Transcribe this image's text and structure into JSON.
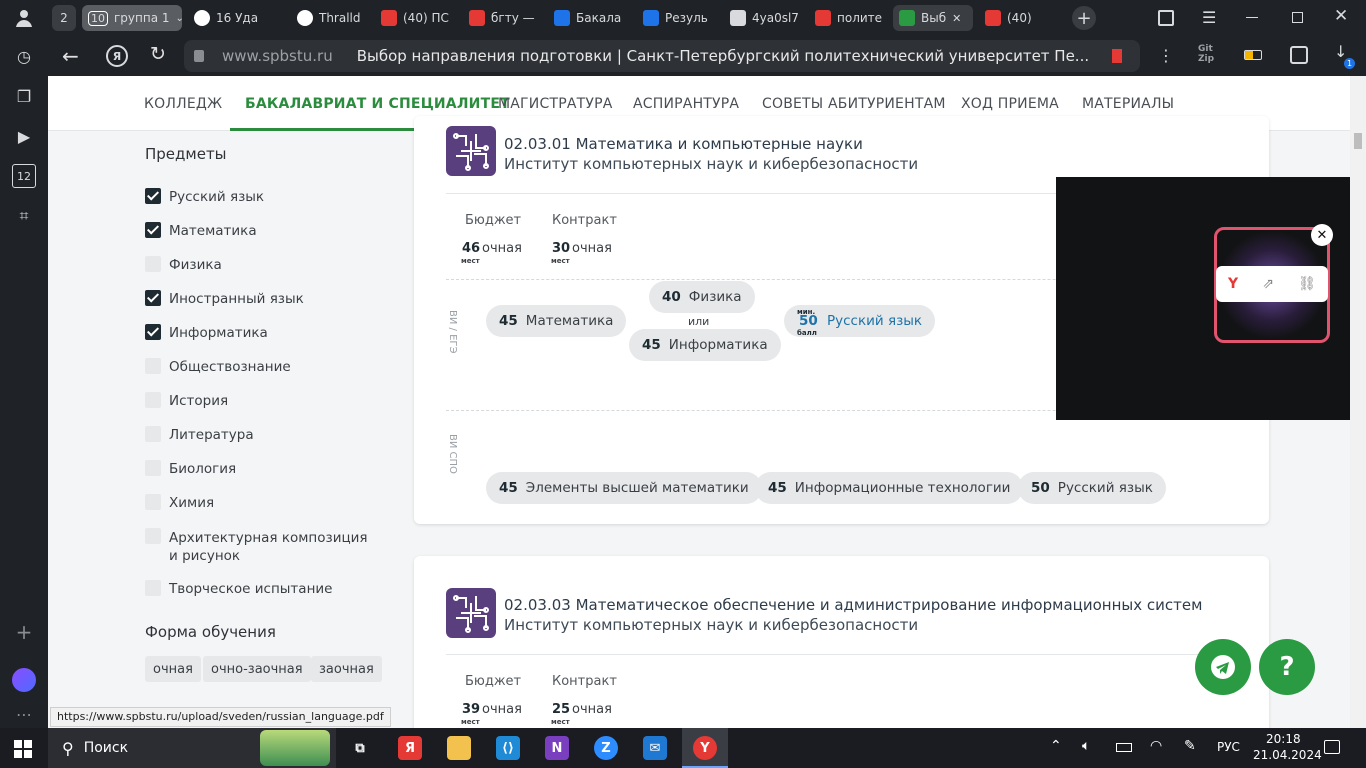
{
  "browser": {
    "tab_group_count": "2",
    "tab_group_badge": "10",
    "tab_group_label": "группа 1",
    "tabs": [
      {
        "label": "16 Уда",
        "icon": "github-icon"
      },
      {
        "label": "Thralld",
        "icon": "github-icon"
      },
      {
        "label": "(40) ПС",
        "icon": "youtube-icon"
      },
      {
        "label": "бгту —",
        "icon": "yandex-icon"
      },
      {
        "label": "Бакала",
        "icon": "bookmark-flag-icon"
      },
      {
        "label": "Резуль",
        "icon": "bookmark-flag-icon"
      },
      {
        "label": "4ya0sl7",
        "icon": "document-icon"
      },
      {
        "label": "полите",
        "icon": "yandex-icon"
      },
      {
        "label": "Выб",
        "icon": "polytech-icon"
      },
      {
        "label": "(40)",
        "icon": "youtube-icon"
      }
    ],
    "domain": "www.spbstu.ru",
    "page_title": "Выбор направления подготовки | Санкт-Петербургский политехнический университет Пе...",
    "downloads_badge": "1",
    "status_url": "https://www.spbstu.ru/upload/sveden/russian_language.pdf"
  },
  "sidebar_badges": {
    "tabs_count": "12"
  },
  "nav": {
    "items": [
      "КОЛЛЕДЖ",
      "БАКАЛАВРИАТ И СПЕЦИАЛИТЕТ",
      "МАГИСТРАТУРА",
      "АСПИРАНТУРА",
      "СОВЕТЫ АБИТУРИЕНТАМ",
      "ХОД ПРИЕМА",
      "МАТЕРИАЛЫ"
    ]
  },
  "filters": {
    "subjects_title": "Предметы",
    "subjects": [
      {
        "label": "Русский язык",
        "checked": true
      },
      {
        "label": "Математика",
        "checked": true
      },
      {
        "label": "Физика",
        "checked": false
      },
      {
        "label": "Иностранный язык",
        "checked": true
      },
      {
        "label": "Информатика",
        "checked": true
      },
      {
        "label": "Обществознание",
        "checked": false
      },
      {
        "label": "История",
        "checked": false
      },
      {
        "label": "Литература",
        "checked": false
      },
      {
        "label": "Биология",
        "checked": false
      },
      {
        "label": "Химия",
        "checked": false
      },
      {
        "label": "Архитектурная композиция и рисунок",
        "checked": false
      },
      {
        "label": "Творческое испытание",
        "checked": false
      }
    ],
    "form_title": "Форма обучения",
    "forms": [
      "очная",
      "очно-заочная",
      "заочная"
    ]
  },
  "programs": [
    {
      "title": "02.03.01 Математика и компьютерные науки",
      "institute": "Институт компьютерных наук и кибербезопасности",
      "budget_label": "Бюджет",
      "budget_num": "46",
      "budget_form": "очная",
      "contract_label": "Контракт",
      "contract_num": "30",
      "contract_form": "очная",
      "places_word": "мест",
      "ege_label": "ВИ / ЕГЭ",
      "ege": {
        "math": {
          "score": "45",
          "name": "Математика"
        },
        "phys": {
          "score": "40",
          "name": "Физика"
        },
        "or": "или",
        "inf": {
          "score": "45",
          "name": "Информатика"
        },
        "rus": {
          "min": "мин.",
          "score": "50",
          "unit": "балл",
          "name": "Русский язык"
        }
      },
      "spo_label": "ВИ СПО",
      "spo": [
        {
          "score": "45",
          "name": "Элементы высшей математики"
        },
        {
          "score": "45",
          "name": "Информационные технологии"
        },
        {
          "score": "50",
          "name": "Русский язык"
        }
      ]
    },
    {
      "title": "02.03.03 Математическое обеспечение и администрирование информационных систем",
      "institute": "Институт компьютерных наук и кибербезопасности",
      "budget_label": "Бюджет",
      "budget_num": "39",
      "budget_form": "очная",
      "contract_label": "Контракт",
      "contract_num": "25",
      "contract_form": "очная",
      "places_word": "мест"
    }
  ],
  "taskbar": {
    "search_label": "Поиск",
    "lang": "РУС",
    "time": "20:18",
    "date": "21.04.2024"
  }
}
